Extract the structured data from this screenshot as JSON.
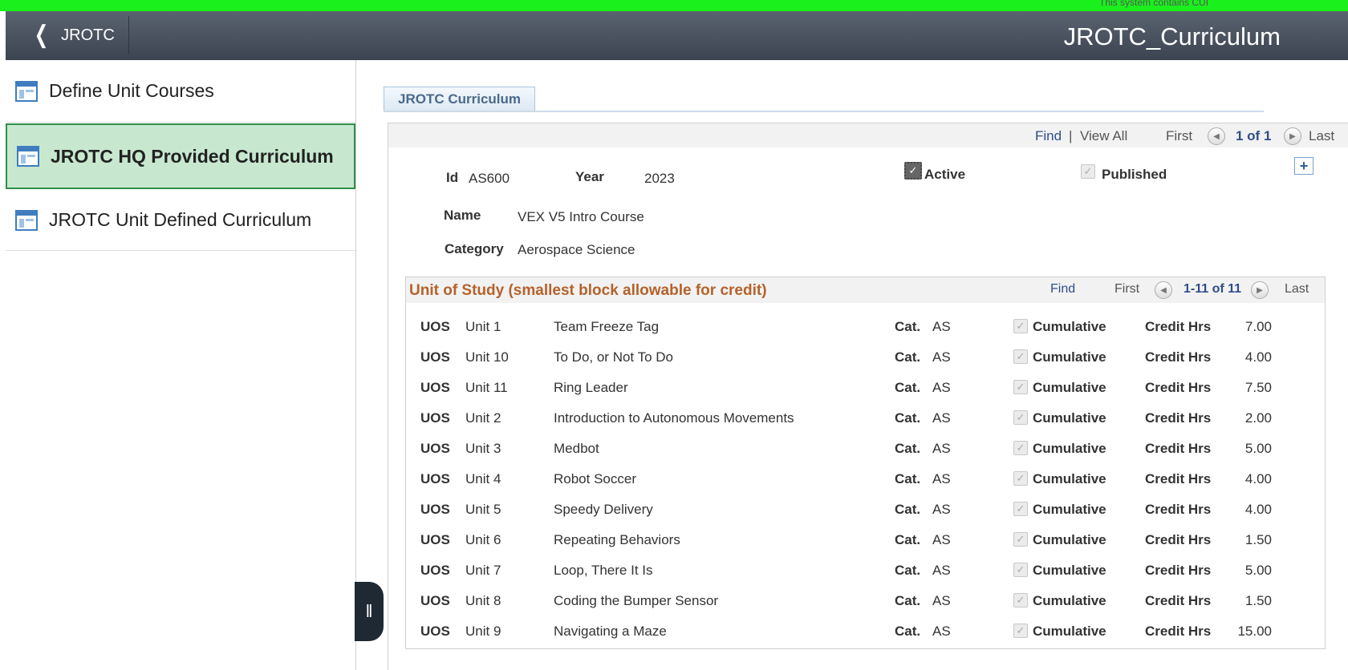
{
  "banner": {
    "text": "This system contains CUI",
    "color": "#19f01c"
  },
  "header": {
    "back_label": "JROTC",
    "title": "JROTC_Curriculum"
  },
  "sidebar": {
    "items": [
      {
        "label": "Define Unit Courses",
        "icon": "page-icon",
        "selected": false
      },
      {
        "label": "JROTC HQ Provided Curriculum",
        "icon": "page-icon",
        "selected": true
      },
      {
        "label": "JROTC Unit Defined Curriculum",
        "icon": "page-icon",
        "selected": false
      }
    ]
  },
  "tab": {
    "label": "JROTC Curriculum"
  },
  "main_nav": {
    "find": "Find",
    "sep": "|",
    "view_all": "View All",
    "first": "First",
    "count": "1 of 1",
    "last": "Last"
  },
  "record": {
    "id_label": "Id",
    "id": "AS600",
    "year_label": "Year",
    "year": "2023",
    "active_label": "Active",
    "active": true,
    "published_label": "Published",
    "published": true,
    "name_label": "Name",
    "name": "VEX V5 Intro Course",
    "category_label": "Category",
    "category": "Aerospace Science"
  },
  "uos": {
    "title": "Unit of Study (smallest block allowable for credit)",
    "nav": {
      "find": "Find",
      "first": "First",
      "count": "1-11 of 11",
      "last": "Last"
    },
    "labels": {
      "uos": "UOS",
      "cat": "Cat.",
      "cumulative": "Cumulative",
      "credit": "Credit Hrs"
    },
    "rows": [
      {
        "unit": "Unit 1",
        "desc": "Team Freeze Tag",
        "cat": "AS",
        "cumulative": true,
        "credit": "7.00"
      },
      {
        "unit": "Unit 10",
        "desc": "To Do, or Not To Do",
        "cat": "AS",
        "cumulative": true,
        "credit": "4.00"
      },
      {
        "unit": "Unit 11",
        "desc": "Ring Leader",
        "cat": "AS",
        "cumulative": true,
        "credit": "7.50"
      },
      {
        "unit": "Unit 2",
        "desc": "Introduction to Autonomous Movements",
        "cat": "AS",
        "cumulative": true,
        "credit": "2.00"
      },
      {
        "unit": "Unit 3",
        "desc": "Medbot",
        "cat": "AS",
        "cumulative": true,
        "credit": "5.00"
      },
      {
        "unit": "Unit 4",
        "desc": "Robot Soccer",
        "cat": "AS",
        "cumulative": true,
        "credit": "4.00"
      },
      {
        "unit": "Unit 5",
        "desc": "Speedy Delivery",
        "cat": "AS",
        "cumulative": true,
        "credit": "4.00"
      },
      {
        "unit": "Unit 6",
        "desc": "Repeating Behaviors",
        "cat": "AS",
        "cumulative": true,
        "credit": "1.50"
      },
      {
        "unit": "Unit 7",
        "desc": "Loop, There It Is",
        "cat": "AS",
        "cumulative": true,
        "credit": "5.00"
      },
      {
        "unit": "Unit 8",
        "desc": "Coding the Bumper Sensor",
        "cat": "AS",
        "cumulative": true,
        "credit": "1.50"
      },
      {
        "unit": "Unit 9",
        "desc": "Navigating a Maze",
        "cat": "AS",
        "cumulative": true,
        "credit": "15.00"
      }
    ]
  }
}
